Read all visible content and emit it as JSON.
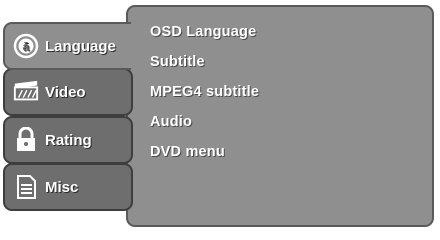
{
  "tabs": [
    {
      "label": "Language",
      "icon": "language-icon",
      "active": true
    },
    {
      "label": "Video",
      "icon": "video-icon",
      "active": false
    },
    {
      "label": "Rating",
      "icon": "lock-icon",
      "active": false
    },
    {
      "label": "Misc",
      "icon": "document-icon",
      "active": false
    }
  ],
  "options": [
    {
      "label": "OSD Language"
    },
    {
      "label": "Subtitle"
    },
    {
      "label": "MPEG4 subtitle"
    },
    {
      "label": "Audio"
    },
    {
      "label": "DVD menu"
    }
  ],
  "colors": {
    "panel": "#8f8f8f",
    "tab_inactive": "#6e6e6e",
    "border": "#3e3e3e",
    "text": "#ffffff"
  }
}
